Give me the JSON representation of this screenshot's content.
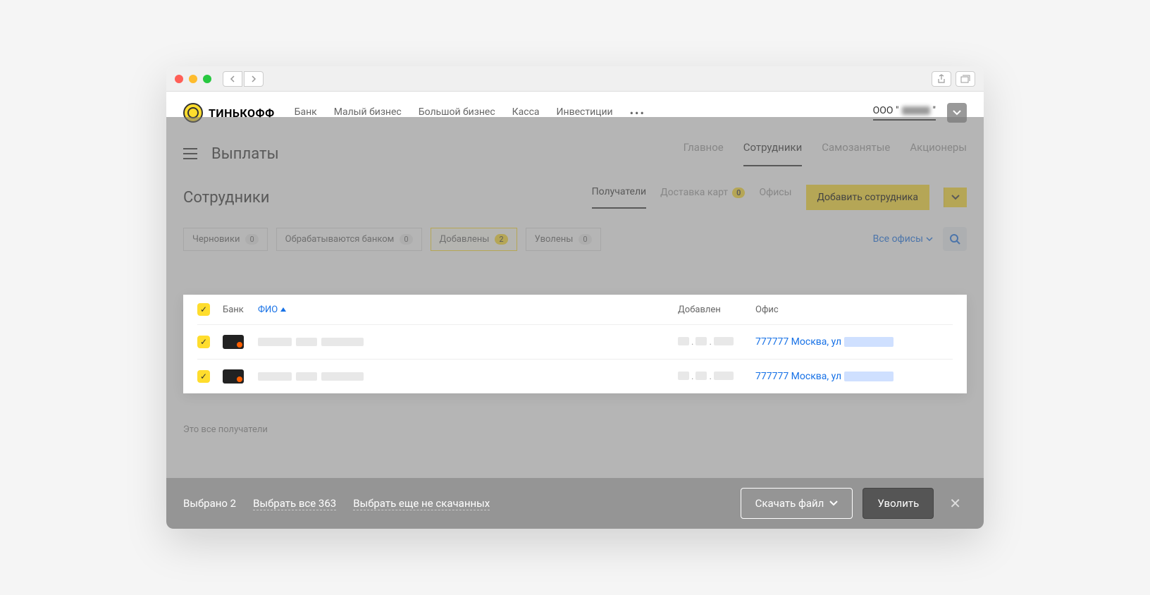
{
  "brand": "ТИНЬКОФФ",
  "topnav": {
    "links": [
      "Банк",
      "Малый бизнес",
      "Большой бизнес",
      "Касса",
      "Инвестиции"
    ],
    "company_prefix": "ООО \""
  },
  "subnav": {
    "title": "Выплаты",
    "tabs": [
      "Главное",
      "Сотрудники",
      "Самозанятые",
      "Акционеры"
    ],
    "active": "Сотрудники"
  },
  "section": {
    "title": "Сотрудники",
    "tabs": [
      {
        "label": "Получатели",
        "active": true
      },
      {
        "label": "Доставка карт",
        "badge": "0"
      },
      {
        "label": "Офисы"
      }
    ],
    "add_button": "Добавить сотрудника"
  },
  "filters": {
    "items": [
      {
        "label": "Черновики",
        "count": "0"
      },
      {
        "label": "Обрабатываются банком",
        "count": "0"
      },
      {
        "label": "Добавлены",
        "count": "2",
        "active": true
      },
      {
        "label": "Уволены",
        "count": "0"
      }
    ],
    "all_offices": "Все офисы"
  },
  "table": {
    "headers": {
      "bank": "Банк",
      "name": "ФИО",
      "added": "Добавлен",
      "office": "Офис"
    },
    "rows": [
      {
        "office_text": "777777 Москва, ул"
      },
      {
        "office_text": "777777 Москва, ул"
      }
    ]
  },
  "end_text": "Это все получатели",
  "footer": {
    "selected": "Выбрано 2",
    "select_all": "Выбрать все 363",
    "select_more": "Выбрать еще не скачанных",
    "download": "Скачать файл",
    "fire": "Уволить"
  }
}
